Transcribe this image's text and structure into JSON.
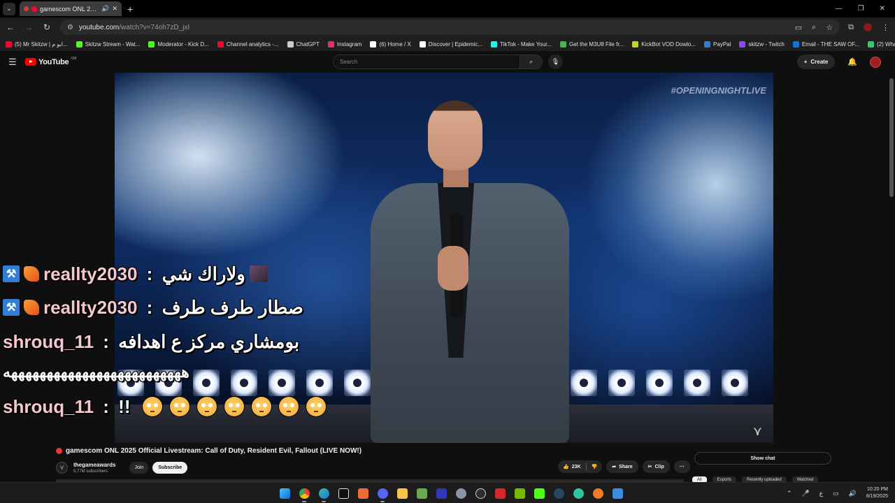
{
  "browser": {
    "tab_title": "gamescom ONL 2025 O",
    "url_host": "youtube.com",
    "url_path": "/watch?v=74oh7zD_jxI",
    "bookmarks": [
      {
        "label": "(5) Mr Skitzw | ابو م...",
        "color": "#ff0033"
      },
      {
        "label": "Skitzw Stream - Wat...",
        "color": "#53fc18"
      },
      {
        "label": "Moderator - Kick D...",
        "color": "#53fc18"
      },
      {
        "label": "Channel analytics -...",
        "color": "#ff0033"
      },
      {
        "label": "ChatGPT",
        "color": "#cccccc"
      },
      {
        "label": "Instagram",
        "color": "#e1306c"
      },
      {
        "label": "(6) Home / X",
        "color": "#ffffff"
      },
      {
        "label": "Discover | Epidemic...",
        "color": "#ffffff"
      },
      {
        "label": "TikTok - Make Your...",
        "color": "#25f4ee"
      },
      {
        "label": "Get the M3U8 File fr...",
        "color": "#3fbf3f"
      },
      {
        "label": "KickBot VOD Dowlo...",
        "color": "#c9d12a"
      },
      {
        "label": "PayPal",
        "color": "#2a7fd4"
      },
      {
        "label": "skitzw - Twitch",
        "color": "#9146ff"
      },
      {
        "label": "Email - THE SAW OF...",
        "color": "#0f78d4"
      },
      {
        "label": "(2) WhatsApp",
        "color": "#25d366"
      }
    ]
  },
  "youtube": {
    "logo_text": "YouTube",
    "logo_country": "OM",
    "search_placeholder": "Search",
    "create_label": "Create"
  },
  "video": {
    "overlay_tag": "#OPENINGNIGHTLIVE",
    "title": "gamescom ONL 2025 Official Livestream: Call of Duty, Resident Evil, Fallout (LIVE NOW!)",
    "channel_name": "thegameawards",
    "subscribers": "5.77M subscribers",
    "join_label": "Join",
    "subscribe_label": "Subscribe",
    "likes": "23K",
    "share_label": "Share",
    "clip_label": "Clip",
    "show_chat_label": "Show chat"
  },
  "chat_overlay": [
    {
      "user": "reallty2030",
      "sep": " : ",
      "message": "ولاراك شي"
    },
    {
      "user": "reallty2030",
      "sep": " : ",
      "message": "صطار طرف طرف"
    },
    {
      "user": "shrouq_11",
      "sep": " : ",
      "message": "بومشاري مركز ع اهدافه"
    },
    {
      "message": "هههههههههههههههههههههههههه"
    },
    {
      "user": "shrouq_11",
      "sep": " : ",
      "message": "!!"
    }
  ],
  "chips": [
    "All",
    "Esports",
    "Recently uploaded",
    "Watched"
  ],
  "taskbar": {
    "time": "10:20 PM",
    "date": "8/19/2025",
    "lang": "ع"
  },
  "colors": {
    "accent_red": "#ff0000",
    "live_red": "#e53935",
    "mod_badge": "#2f7fd6",
    "username": "#f6c7cf"
  }
}
